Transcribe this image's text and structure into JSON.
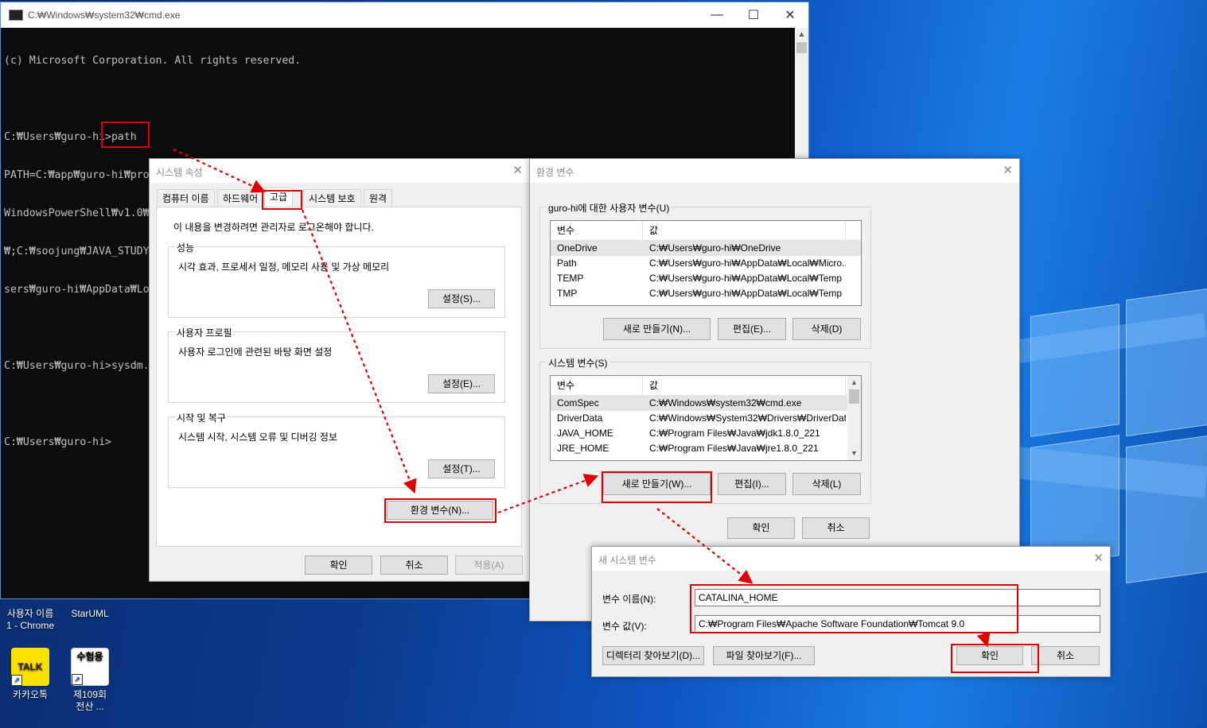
{
  "desktop": {
    "icons": [
      {
        "label": "사용자 이름\n1 - Chrome"
      },
      {
        "label": "StarUML"
      },
      {
        "label": "카카오톡",
        "glyph": "TALK"
      },
      {
        "label": "제109회\n전산 ...",
        "glyph": "수험용"
      }
    ]
  },
  "cmd": {
    "title": "C:₩Windows₩system32₩cmd.exe",
    "lines": [
      "(c) Microsoft Corporation. All rights reserved.",
      "",
      "C:₩Users₩guro-hi>path",
      "PATH=C:₩app₩guro-hi₩product₩11.2.0₩dbhome_1₩bin;C:₩Windows₩system32;C:₩Windows;C:₩Windows₩System32₩Wbem;C:₩Windows₩System32₩",
      "WindowsPowerShell₩v1.0₩;C:₩Windows₩System32₩OpenSSH₩;C:₩Program Files₩Git₩cmd;C:₩Program Files₩Git;C:₩Program Files₩Perforce",
      "₩;C:₩soojung₩JAVA_STUDY₩chapter01_path_ex;C:₩Program Files₩Java₩jdk1.8.0_221₩bin;C:₩Program Files₩Java₩jre1.8.0_221₩bin;C:₩U",
      "sers₩guro-hi₩AppData₩Local₩Microsoft₩WindowsApps;;C:₩Users₩guro-hi₩AppData₩Local₩Programs₩Microsoft VS Code₩bin",
      "",
      "C:₩Users₩guro-hi>sysdm.cpl",
      "",
      "C:₩Users₩guro-hi>"
    ]
  },
  "sysprops": {
    "title": "시스템 속성",
    "tabs": [
      "컴퓨터 이름",
      "하드웨어",
      "고급",
      "시스템 보호",
      "원격"
    ],
    "admin_note": "이 내용을 변경하려면 관리자로 로그온해야 합니다.",
    "groups": [
      {
        "title": "성능",
        "desc": "시각 효과, 프로세서 일정, 메모리 사용 및 가상 메모리",
        "button": "설정(S)..."
      },
      {
        "title": "사용자 프로필",
        "desc": "사용자 로그인에 관련된 바탕 화면 설정",
        "button": "설정(E)..."
      },
      {
        "title": "시작 및 복구",
        "desc": "시스템 시작, 시스템 오류 및 디버깅 정보",
        "button": "설정(T)..."
      }
    ],
    "env_button": "환경 변수(N)...",
    "ok": "확인",
    "cancel": "취소",
    "apply": "적용(A)"
  },
  "envvars": {
    "title": "환경 변수",
    "user_group": "guro-hi에 대한 사용자 변수(U)",
    "col_var": "변수",
    "col_val": "값",
    "user_vars": [
      {
        "name": "OneDrive",
        "value": "C:₩Users₩guro-hi₩OneDrive"
      },
      {
        "name": "Path",
        "value": "C:₩Users₩guro-hi₩AppData₩Local₩Micro..."
      },
      {
        "name": "TEMP",
        "value": "C:₩Users₩guro-hi₩AppData₩Local₩Temp"
      },
      {
        "name": "TMP",
        "value": "C:₩Users₩guro-hi₩AppData₩Local₩Temp"
      }
    ],
    "user_buttons": [
      "새로 만들기(N)...",
      "편집(E)...",
      "삭제(D)"
    ],
    "sys_group": "시스템 변수(S)",
    "sys_vars": [
      {
        "name": "ComSpec",
        "value": "C:₩Windows₩system32₩cmd.exe"
      },
      {
        "name": "DriverData",
        "value": "C:₩Windows₩System32₩Drivers₩DriverData"
      },
      {
        "name": "JAVA_HOME",
        "value": "C:₩Program Files₩Java₩jdk1.8.0_221"
      },
      {
        "name": "JRE_HOME",
        "value": "C:₩Program Files₩Java₩jre1.8.0_221"
      }
    ],
    "sys_buttons": [
      "새로 만들기(W)...",
      "편집(I)...",
      "삭제(L)"
    ],
    "ok": "확인",
    "cancel": "취소"
  },
  "newsysvar": {
    "title": "새 시스템 변수",
    "name_label": "변수 이름(N):",
    "name_value": "CATALINA_HOME",
    "value_label": "변수 값(V):",
    "value_value": "C:₩Program Files₩Apache Software Foundation₩Tomcat 9.0",
    "browse_dir": "디렉터리 찾아보기(D)...",
    "browse_file": "파일 찾아보기(F)...",
    "ok": "확인",
    "cancel": "취소"
  },
  "colors": {
    "annotation": "#e00000",
    "console_bg": "#0c0c0c",
    "dialog_bg": "#f0f0f0"
  }
}
